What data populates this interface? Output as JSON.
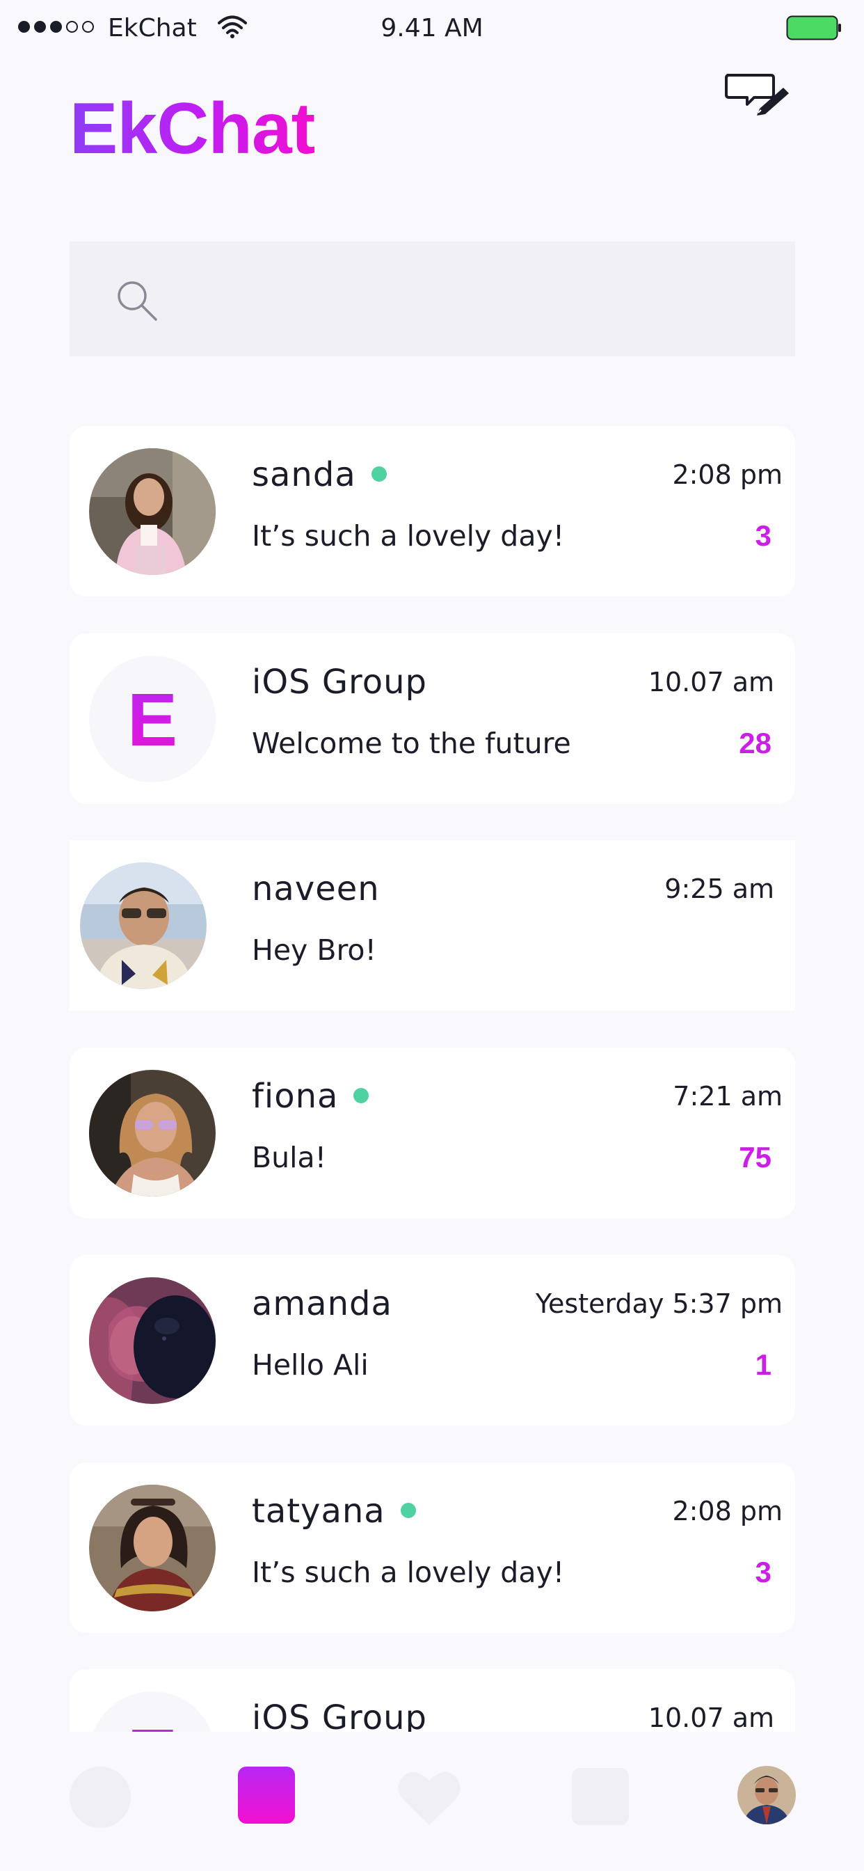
{
  "status_bar": {
    "carrier": "EkChat",
    "time": "9.41 AM",
    "signal_icon": "signal-dots-icon",
    "wifi_icon": "wifi-icon",
    "battery_icon": "battery-full-icon"
  },
  "header": {
    "title": "EkChat",
    "compose_icon": "compose-message-icon",
    "title_gradient": [
      "#8f3cf7",
      "#f20fd0"
    ]
  },
  "search": {
    "icon": "search-icon",
    "placeholder": "",
    "value": ""
  },
  "chats": [
    {
      "name": "sanda",
      "online": true,
      "preview": "It’s such a lovely day!",
      "time": "2:08 pm",
      "unread": "3",
      "avatar": "photo"
    },
    {
      "name": "iOS Group",
      "online": false,
      "preview": "Welcome to the future",
      "time": "10.07 am",
      "unread": "28",
      "avatar_letter": "E"
    },
    {
      "name": "naveen",
      "online": false,
      "preview": "Hey Bro!",
      "time": "9:25 am",
      "unread": "",
      "avatar": "photo"
    },
    {
      "name": "fiona",
      "online": true,
      "preview": "Bula!",
      "time": "7:21 am",
      "unread": "75",
      "avatar": "photo"
    },
    {
      "name": "amanda",
      "online": false,
      "preview": "Hello Ali",
      "time": "Yesterday 5:37 pm",
      "unread": "1",
      "avatar": "photo"
    },
    {
      "name": "tatyana",
      "online": true,
      "preview": "It’s such a lovely day!",
      "time": "2:08 pm",
      "unread": "3",
      "avatar": "photo"
    },
    {
      "name": "iOS Group",
      "online": false,
      "preview": "",
      "time": "10.07 am",
      "unread": "",
      "avatar_letter": "E"
    }
  ],
  "tab_bar": {
    "tabs": [
      "home",
      "chats",
      "favorites",
      "files",
      "profile"
    ],
    "active": "chats",
    "icons": [
      "home-icon",
      "chats-icon",
      "heart-icon",
      "files-icon",
      "profile-avatar"
    ]
  },
  "colors": {
    "accent": "#cc1fe6",
    "online": "#4fd1a1",
    "background": "#f8f8fd",
    "card": "#ffffff",
    "battery": "#4cd964"
  }
}
